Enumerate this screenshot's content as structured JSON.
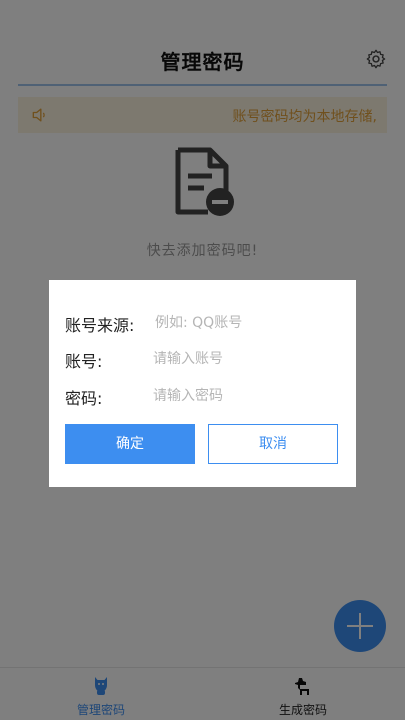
{
  "header": {
    "title": "管理密码"
  },
  "notice": {
    "text": "账号密码均为本地存储,"
  },
  "empty_state": {
    "text": "快去添加密码吧!"
  },
  "tabs": [
    {
      "label": "管理密码",
      "active": true
    },
    {
      "label": "生成密码",
      "active": false
    }
  ],
  "dialog": {
    "source_label": "账号来源:",
    "source_placeholder": "例如: QQ账号",
    "account_label": "账号:",
    "account_placeholder": "请输入账号",
    "password_label": "密码:",
    "password_placeholder": "请输入密码",
    "confirm_label": "确定",
    "cancel_label": "取消"
  },
  "colors": {
    "accent": "#3d8ef0",
    "notice_bg": "#fbf2de",
    "notice_text": "#e0a03a"
  },
  "icons": {
    "settings": "gear-icon",
    "notice": "speaker-icon",
    "empty": "document-minus-icon",
    "fab": "plus-icon",
    "tab1": "cat-icon",
    "tab2": "dog-icon"
  }
}
